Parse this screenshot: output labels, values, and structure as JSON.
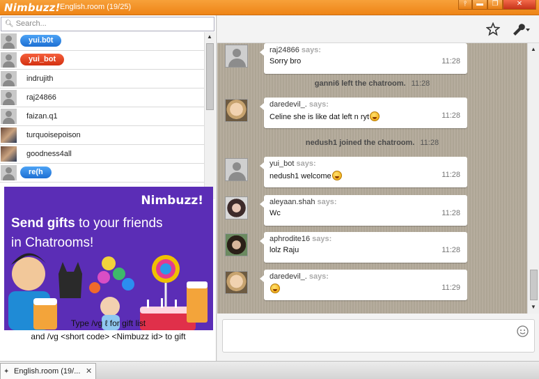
{
  "app": {
    "logo": "Nimbuzz!",
    "window_title": "English.room (19/25)"
  },
  "window_controls": {
    "pin": "⫯",
    "minimize": "▬",
    "restore": "❐",
    "close": "✕"
  },
  "search": {
    "placeholder": "Search..."
  },
  "users": [
    {
      "name": "yui.b0t",
      "style": "pill-blue"
    },
    {
      "name": "yui_bot",
      "style": "pill-red"
    },
    {
      "name": "indrujith",
      "style": "plain"
    },
    {
      "name": "raj24866",
      "style": "plain"
    },
    {
      "name": "faizan.q1",
      "style": "plain"
    },
    {
      "name": "turquoisepoison",
      "style": "photo"
    },
    {
      "name": "goodness4all",
      "style": "photo"
    },
    {
      "name": "re(h",
      "style": "pill-blue"
    }
  ],
  "promo": {
    "logo": "Nimbuzz!",
    "headline_bold": "Send gifts",
    "headline_rest": " to your friends",
    "headline_line2": "in Chatrooms!",
    "caption_line1": "Type /vg ℓ for gift list",
    "caption_line2": "and /vg <short code> <Nimbuzz id> to gift"
  },
  "toolbar": {
    "favorite_icon": "star-icon",
    "settings_icon": "wrench-icon"
  },
  "messages": [
    {
      "type": "msg",
      "user": "raj24866",
      "says": "says:",
      "text": "Sorry bro",
      "time": "11:28",
      "avatar": "default"
    },
    {
      "type": "system",
      "text": "ganni6 left the chatroom.",
      "time": "11:28"
    },
    {
      "type": "msg",
      "user": "daredevil_.",
      "says": "says:",
      "text": "Celine she is like dat left n ryt",
      "time": "11:28",
      "avatar": "kid",
      "emoticon": true
    },
    {
      "type": "system",
      "text": "nedush1 joined the chatroom.",
      "time": "11:28"
    },
    {
      "type": "msg",
      "user": "yui_bot",
      "says": "says:",
      "text": "nedush1 welcome",
      "time": "11:28",
      "avatar": "default",
      "emoticon": true
    },
    {
      "type": "msg",
      "user": "aleyaan.shah",
      "says": "says:",
      "text": "Wc",
      "time": "11:28",
      "avatar": "girl1"
    },
    {
      "type": "msg",
      "user": "aphrodite16",
      "says": "says:",
      "text": "lolz Raju",
      "time": "11:28",
      "avatar": "girl2"
    },
    {
      "type": "msg",
      "user": "daredevil_.",
      "says": "says:",
      "text": "",
      "time": "11:29",
      "avatar": "kid",
      "emoticon": true
    }
  ],
  "input": {
    "emoticon_icon": "smiley-icon"
  },
  "taskbar": {
    "tab_label": "English.room (19/...",
    "close": "✕"
  }
}
